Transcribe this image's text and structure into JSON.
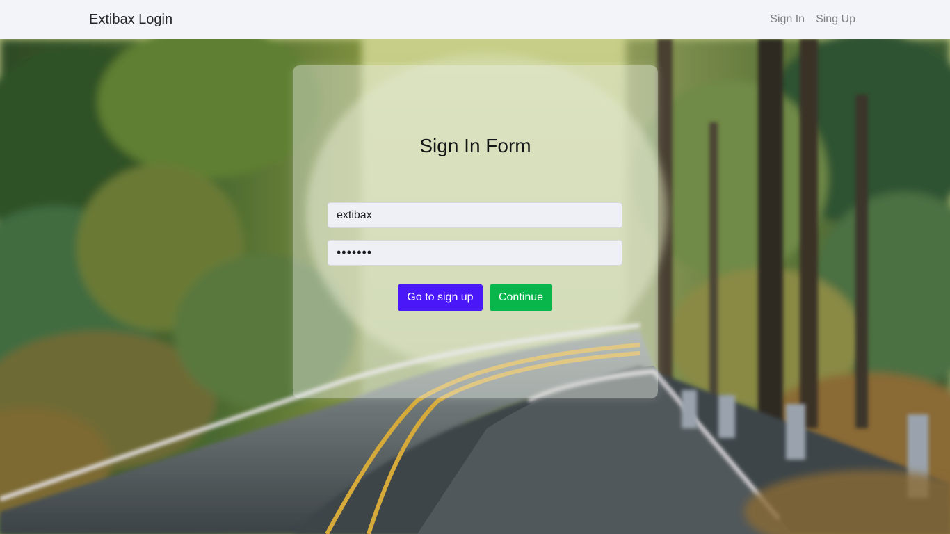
{
  "navbar": {
    "brand": "Extibax Login",
    "links": [
      "Sign In",
      "Sing Up"
    ]
  },
  "form": {
    "title": "Sign In Form",
    "username_value": "extibax",
    "password_value": "•••••••",
    "signup_button": "Go to sign up",
    "continue_button": "Continue"
  },
  "colors": {
    "navbar_bg": "#f3f4f9",
    "signup_button": "#4a17f8",
    "continue_button": "#08b64c"
  },
  "background": {
    "scene": "forest road"
  }
}
